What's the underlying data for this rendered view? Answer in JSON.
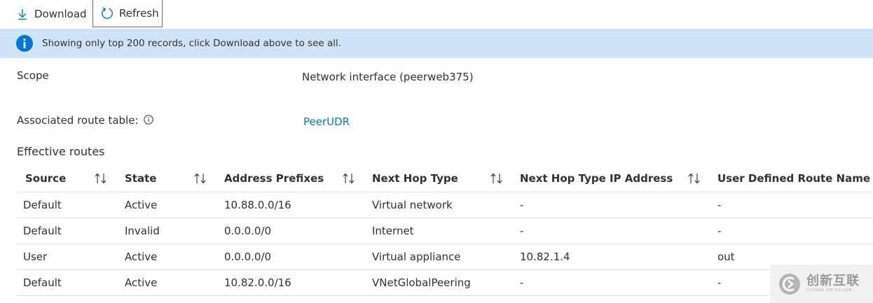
{
  "toolbar": {
    "download_label": "Download",
    "refresh_label": "Refresh"
  },
  "banner": {
    "text": "Showing only top 200 records, click Download above to see all."
  },
  "scope": {
    "label": "Scope",
    "value": "Network interface (peerweb375)"
  },
  "route_table": {
    "label": "Associated route table:",
    "value": "PeerUDR"
  },
  "section_title": "Effective routes",
  "table": {
    "headers": [
      "Source",
      "State",
      "Address Prefixes",
      "Next Hop Type",
      "Next Hop Type IP Address",
      "User Defined Route Name"
    ],
    "rows": [
      [
        "Default",
        "Active",
        "10.88.0.0/16",
        "Virtual network",
        "-",
        "-"
      ],
      [
        "Default",
        "Invalid",
        "0.0.0.0/0",
        "Internet",
        "-",
        "-"
      ],
      [
        "User",
        "Active",
        "0.0.0.0/0",
        "Virtual appliance",
        "10.82.1.4",
        "out"
      ],
      [
        "Default",
        "Active",
        "10.82.0.0/16",
        "VNetGlobalPeering",
        "-",
        "-"
      ]
    ]
  },
  "watermark": {
    "cn": "创新互联",
    "en": "CHUANG XIN HU LIAN"
  },
  "colors": {
    "accent": "#0078d4",
    "banner_bg": "#cfe3f8",
    "text": "#323130",
    "divider": "#e1dfdd"
  }
}
